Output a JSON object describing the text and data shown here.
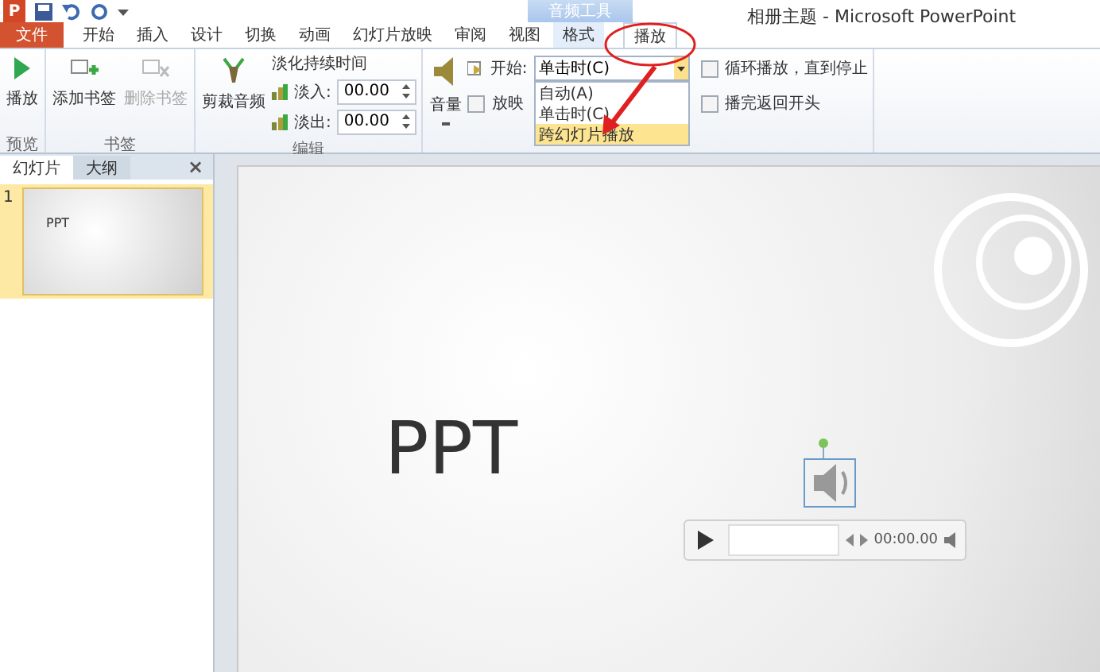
{
  "title_bar": {
    "title": "相册主题 - Microsoft PowerPoint",
    "contextual_group": "音频工具",
    "app_letter": "P"
  },
  "tabs": [
    {
      "label": "文件",
      "kind": "file",
      "selected": false
    },
    {
      "label": "开始",
      "kind": "tab",
      "selected": false
    },
    {
      "label": "插入",
      "kind": "tab",
      "selected": false
    },
    {
      "label": "设计",
      "kind": "tab",
      "selected": false
    },
    {
      "label": "切换",
      "kind": "tab",
      "selected": false
    },
    {
      "label": "动画",
      "kind": "tab",
      "selected": false
    },
    {
      "label": "幻灯片放映",
      "kind": "tab",
      "selected": false
    },
    {
      "label": "审阅",
      "kind": "tab",
      "selected": false
    },
    {
      "label": "视图",
      "kind": "tab",
      "selected": false
    },
    {
      "label": "格式",
      "kind": "context",
      "selected": false
    },
    {
      "label": "播放",
      "kind": "context",
      "selected": true
    }
  ],
  "ribbon": {
    "preview": {
      "label": "预览",
      "play": "播放"
    },
    "bookmarks": {
      "label": "书签",
      "buttons": [
        {
          "label": "添加书签",
          "disabled": false
        },
        {
          "label": "删除书签",
          "disabled": true
        }
      ]
    },
    "editing": {
      "label": "编辑",
      "trim": "剪裁音频",
      "fade_title": "淡化持续时间",
      "fades": [
        {
          "label": "淡入:",
          "value": "00.00"
        },
        {
          "label": "淡出:",
          "value": "00.00"
        }
      ]
    },
    "audio_options": {
      "volume": "音量",
      "start_label": "开始:",
      "start_value": "单击时(C)",
      "start_options": [
        {
          "label": "自动(A)",
          "selected": false
        },
        {
          "label": "单击时(C)",
          "selected": false
        },
        {
          "label": "跨幻灯片播放",
          "selected": true
        }
      ],
      "hide_checkbox": {
        "label": "放映",
        "checked": false
      },
      "checkboxes": [
        {
          "label": "循环播放，直到停止",
          "checked": false
        },
        {
          "label": "播完返回开头",
          "checked": false
        }
      ]
    }
  },
  "side_panel": {
    "tabs": [
      {
        "label": "幻灯片",
        "selected": true
      },
      {
        "label": "大纲",
        "selected": false
      }
    ],
    "close": "×",
    "slides": [
      {
        "number": "1",
        "title": "PPT",
        "selected": true
      }
    ]
  },
  "slide": {
    "title": "PPT",
    "player": {
      "time": "00:00.00"
    }
  }
}
